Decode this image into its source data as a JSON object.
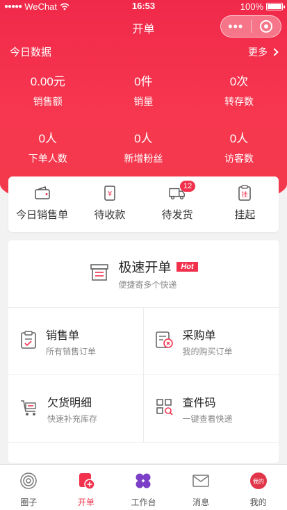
{
  "status_bar": {
    "carrier": "WeChat",
    "time": "16:53",
    "battery": "100%"
  },
  "nav": {
    "title": "开单",
    "more_icon": "more-dots-icon",
    "close_icon": "capsule-close-icon"
  },
  "today": {
    "title": "今日数据",
    "more_label": "更多"
  },
  "stats": [
    {
      "value": "0.00元",
      "label": "销售额"
    },
    {
      "value": "0件",
      "label": "销量"
    },
    {
      "value": "0次",
      "label": "转存数"
    },
    {
      "value": "0人",
      "label": "下单人数"
    },
    {
      "value": "0人",
      "label": "新增粉丝"
    },
    {
      "value": "0人",
      "label": "访客数"
    }
  ],
  "quick_actions": [
    {
      "label": "今日销售单",
      "icon": "wallet-icon"
    },
    {
      "label": "待收款",
      "icon": "receipt-yen-icon"
    },
    {
      "label": "待发货",
      "icon": "truck-icon",
      "badge": "12"
    },
    {
      "label": "挂起",
      "icon": "clipboard-hang-icon",
      "icon_text": "挂"
    }
  ],
  "fast_order": {
    "title": "极速开单",
    "tag": "Hot",
    "subtitle": "便捷寄多个快递"
  },
  "menu": [
    {
      "title": "销售单",
      "subtitle": "所有销售订单",
      "icon": "sales-order-icon"
    },
    {
      "title": "采购单",
      "subtitle": "我的购买订单",
      "icon": "purchase-order-icon"
    },
    {
      "title": "欠货明细",
      "subtitle": "快速补充库存",
      "icon": "cart-icon"
    },
    {
      "title": "查件码",
      "subtitle": "一键查看快递",
      "icon": "qr-search-icon"
    }
  ],
  "tabbar": [
    {
      "label": "圈子",
      "icon": "circle-icon"
    },
    {
      "label": "开单",
      "icon": "order-add-icon",
      "active": true
    },
    {
      "label": "工作台",
      "icon": "workbench-icon"
    },
    {
      "label": "消息",
      "icon": "mail-icon"
    },
    {
      "label": "我的",
      "icon": "profile-icon",
      "icon_text": "我的"
    }
  ],
  "colors": {
    "primary": "#f2314c",
    "workbench": "#7b3fc8"
  }
}
